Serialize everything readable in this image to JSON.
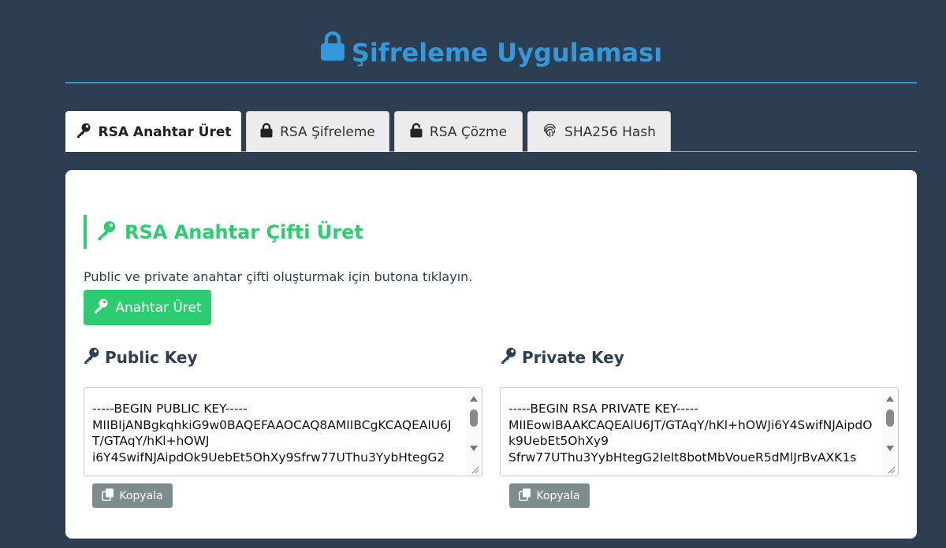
{
  "app": {
    "title": "Şifreleme Uygulaması"
  },
  "tabs": [
    {
      "label": "RSA Anahtar Üret",
      "icon": "key-icon",
      "active": true
    },
    {
      "label": "RSA Şifreleme",
      "icon": "lock-icon",
      "active": false
    },
    {
      "label": "RSA Çözme",
      "icon": "unlock-icon",
      "active": false
    },
    {
      "label": "SHA256 Hash",
      "icon": "fingerprint-icon",
      "active": false
    }
  ],
  "section": {
    "title": "RSA Anahtar Çifti Üret",
    "description": "Public ve private anahtar çifti oluşturmak için butona tıklayın.",
    "generate_button": "Anahtar Üret"
  },
  "public_key": {
    "label": "Public Key",
    "value": "-----BEGIN PUBLIC KEY-----\nMIIBIjANBgkqhkiG9w0BAQEFAAOCAQ8AMIIBCgKCAQEAlU6JT/GTAqY/hKl+hOWJ\ni6Y4SwifNJAipdOk9UebEt5OhXy9Sfrw77UThu3YybHtegG2",
    "copy_button": "Kopyala"
  },
  "private_key": {
    "label": "Private Key",
    "value": "-----BEGIN RSA PRIVATE KEY-----\nMIIEowIBAAKCAQEAlU6JT/GTAqY/hKl+hOWJi6Y4SwifNJAipdOk9UebEt5OhXy9\nSfrw77UThu3YybHtegG2Ielt8botMbVoueR5dMlJrBvAXK1s",
    "copy_button": "Kopyala"
  },
  "colors": {
    "background": "#2c3e50",
    "accent_blue": "#3498db",
    "accent_green": "#2ecc71",
    "copy_button": "#7f8c8d"
  }
}
